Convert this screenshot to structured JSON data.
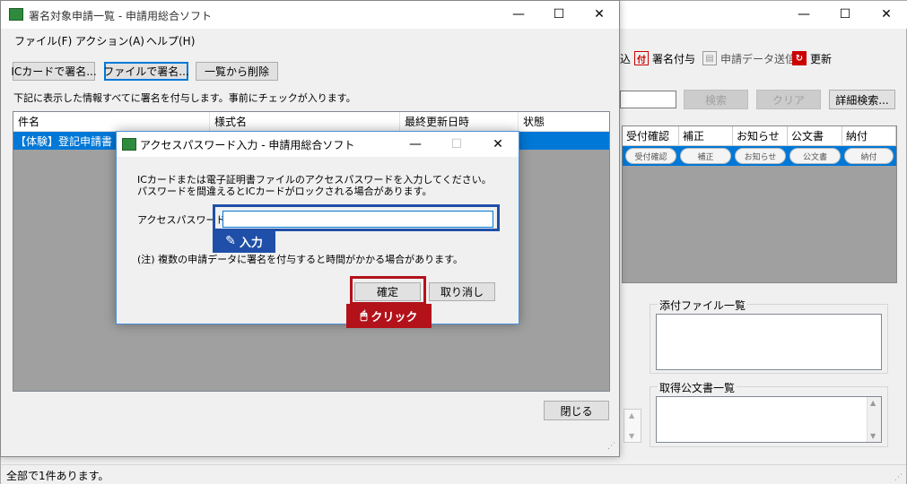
{
  "main_window": {
    "toolbar": {
      "partial_label": "込",
      "sign_label": "署名付与",
      "send_label": "申請データ送信",
      "refresh_label": "更新"
    },
    "search": {
      "search_button": "検索",
      "clear_button": "クリア",
      "detail_button": "詳細検索..."
    },
    "grid_columns": [
      "受付確認",
      "補正",
      "お知らせ",
      "公文書",
      "納付"
    ],
    "grid_row_buttons": [
      "受付確認",
      "補正",
      "お知らせ",
      "公文書",
      "納付"
    ],
    "attachments_label": "添付ファイル一覧",
    "documents_label": "取得公文書一覧",
    "status_text": "全部で1件あります。"
  },
  "list_window": {
    "title": "署名対象申請一覧 - 申請用総合ソフト",
    "menu": [
      "ファイル(F)",
      "アクション(A)",
      "ヘルプ(H)"
    ],
    "buttons": {
      "ic_card": "ICカードで署名...",
      "file": "ファイルで署名...",
      "remove": "一覧から削除"
    },
    "instruction": "下記に表示した情報すべてに署名を付与します。事前にチェックが入ります。",
    "columns": [
      "件名",
      "様式名",
      "最終更新日時",
      "状態"
    ],
    "row": {
      "name": "【体験】登記申請書"
    },
    "close_button": "閉じる"
  },
  "password_dialog": {
    "title": "アクセスパスワード入力 - 申請用総合ソフト",
    "message_line1": "ICカードまたは電子証明書ファイルのアクセスパスワードを入力してください。",
    "message_line2": "パスワードを間違えるとICカードがロックされる場合があります。",
    "password_label": "アクセスパスワード",
    "password_value": "",
    "note": "(注) 複数の申請データに署名を付与すると時間がかかる場合があります。",
    "ok_button": "確定",
    "cancel_button": "取り消し"
  },
  "callouts": {
    "input_label": "入力",
    "click_label": "クリック",
    "input_color": "#1f4fa8",
    "click_color": "#b3121b"
  }
}
